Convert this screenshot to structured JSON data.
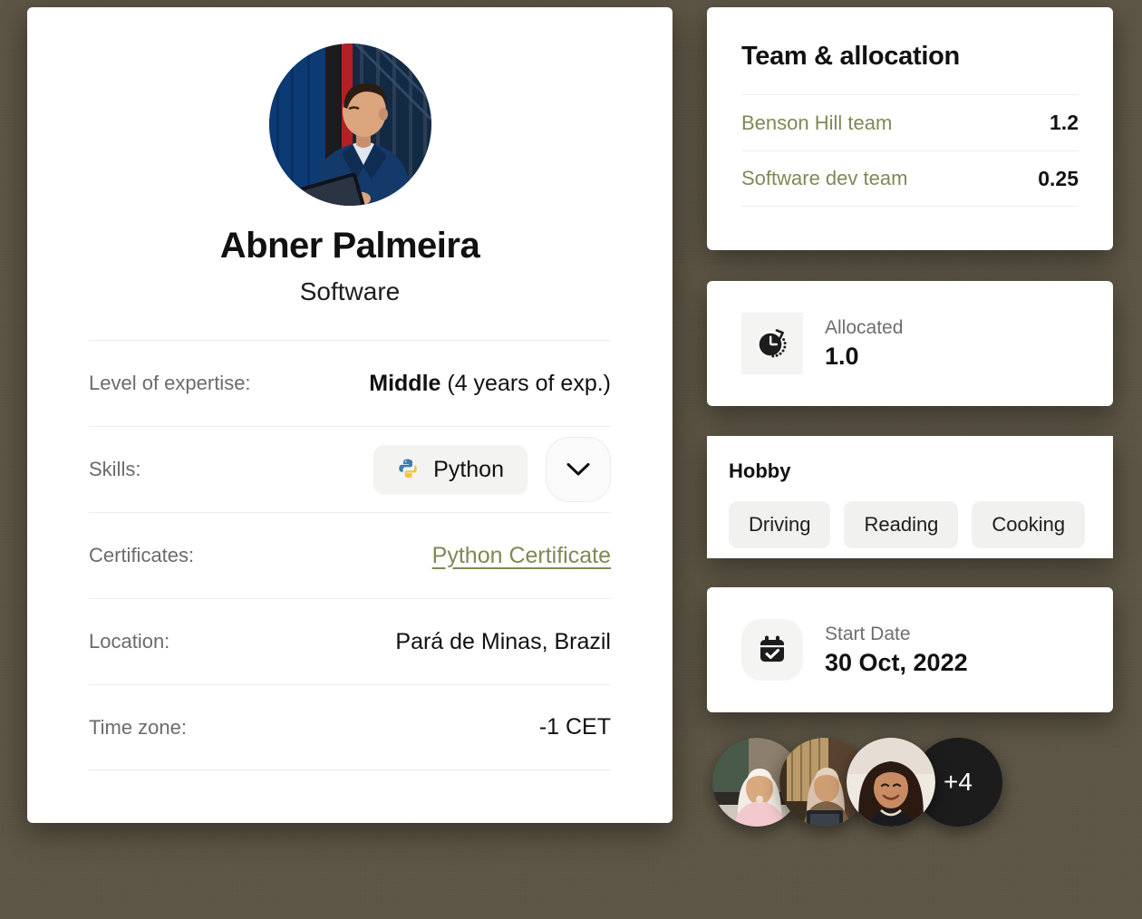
{
  "profile": {
    "avatar_alt": "man-in-navy-blazer-using-tablet",
    "name": "Abner Palmeira",
    "role": "Software",
    "details": [
      {
        "label": "Level of expertise:",
        "value_strong": "Middle",
        "value_light": " (4 years of exp.)",
        "type": "text"
      },
      {
        "label": "Skills:",
        "type": "skills",
        "skills": [
          "Python"
        ],
        "expand_icon": "chevron-down-icon"
      },
      {
        "label": "Certificates:",
        "type": "link",
        "link_text": "Python Certificate"
      },
      {
        "label": "Location:",
        "type": "text",
        "value_strong": "",
        "value_light": "Pará de Minas, Brazil"
      },
      {
        "label": "Time zone:",
        "type": "text",
        "value_strong": "",
        "value_light": "-1 CET"
      }
    ]
  },
  "team_panel": {
    "title": "Team & allocation",
    "rows": [
      {
        "name": "Benson Hill team",
        "value": "1.2"
      },
      {
        "name": "Software dev team",
        "value": "0.25"
      }
    ]
  },
  "allocated": {
    "icon": "clock-icon",
    "label": "Allocated",
    "value": "1.0"
  },
  "hobby": {
    "title": "Hobby",
    "items": [
      "Driving",
      "Reading",
      "Cooking"
    ]
  },
  "start_date": {
    "icon": "calendar-check-icon",
    "label": "Start Date",
    "value": "30 Oct, 2022"
  },
  "members": {
    "avatars": [
      "woman-in-white-hijab-at-laptop",
      "woman-in-beige-hijab-holding-laptop",
      "smiling-woman-with-curly-hair"
    ],
    "overflow_label": "+4"
  },
  "colors": {
    "background": "#5d5544",
    "card": "#ffffff",
    "link_olive": "#7d8a55",
    "chip_bg": "#f1f1ef",
    "text_primary": "#111111",
    "text_muted": "#6b6b6b",
    "overflow_bubble": "#1c1c1c"
  }
}
